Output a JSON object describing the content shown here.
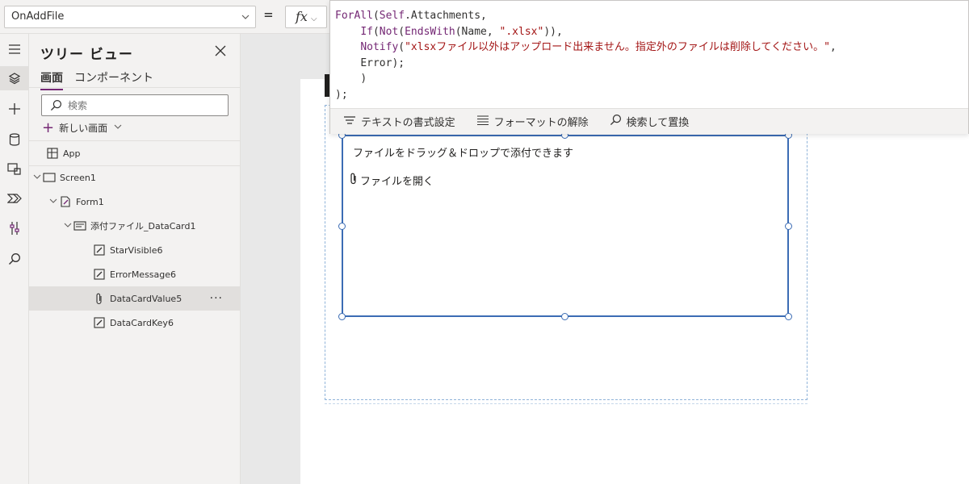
{
  "formula_bar": {
    "property": "OnAddFile",
    "equals": "=",
    "fx_label": "fx"
  },
  "formula": {
    "line1_fn": "ForAll",
    "line1_open": "(",
    "line1_self": "Self",
    "line1_rest": ".Attachments,",
    "line2_fn": "If",
    "line2_open": "(",
    "line2_not": "Not",
    "line2_open2": "(",
    "line2_ends": "EndsWith",
    "line2_args": "(Name, ",
    "line2_str": "\".xlsx\"",
    "line2_close": ")),",
    "line3_fn": "Notify",
    "line3_open": "(",
    "line3_str": "\"xlsxファイル以外はアップロード出来ません。指定外のファイルは削除してください。\"",
    "line3_comma": ",",
    "line4": "Error);",
    "line5": ")",
    "line6": ");"
  },
  "editor_toolbar": {
    "format_text": "テキストの書式設定",
    "remove_format": "フォーマットの解除",
    "find_replace": "検索して置換"
  },
  "tree_view": {
    "title": "ツリー ビュー",
    "tabs": [
      "画面",
      "コンポーネント"
    ],
    "search_placeholder": "検索",
    "new_screen": "新しい画面",
    "app": "App",
    "nodes": [
      {
        "label": "Screen1"
      },
      {
        "label": "Form1"
      },
      {
        "label": "添付ファイル_DataCard1"
      },
      {
        "label": "StarVisible6"
      },
      {
        "label": "ErrorMessage6"
      },
      {
        "label": "DataCardValue5"
      },
      {
        "label": "DataCardKey6"
      }
    ],
    "more": "···"
  },
  "canvas": {
    "drop_text": "ファイルをドラッグ＆ドロップで添付できます",
    "open_file": "ファイルを開く"
  },
  "colors": {
    "accent": "#742774",
    "selection": "#3b6cb4",
    "string": "#a31515"
  }
}
